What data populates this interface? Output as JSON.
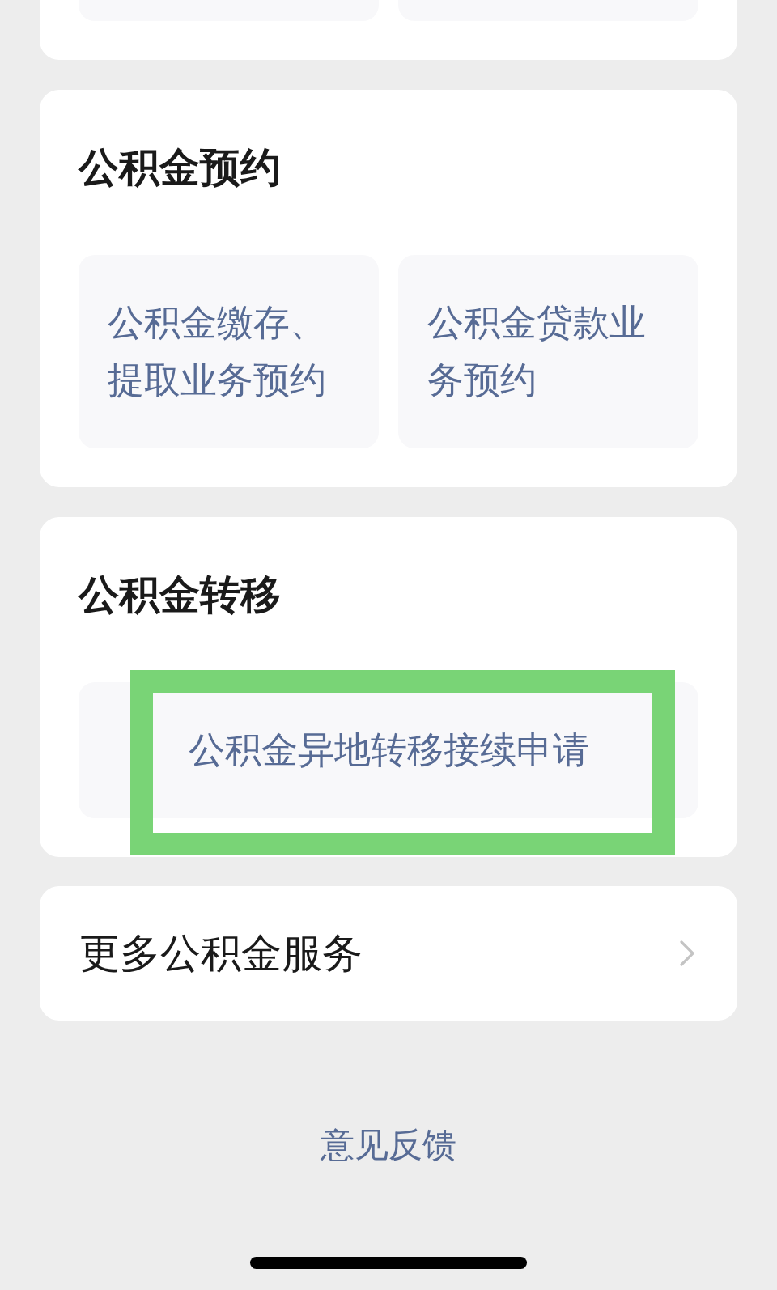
{
  "sections": [
    {
      "kind": "clipped"
    },
    {
      "kind": "tiles",
      "title": "公积金预约",
      "items": [
        {
          "label": "公积金缴存、提取业务预约",
          "highlighted": false
        },
        {
          "label": "公积金贷款业务预约",
          "highlighted": false
        }
      ]
    },
    {
      "kind": "tiles",
      "title": "公积金转移",
      "items": [
        {
          "label": "公积金异地转移接续申请",
          "highlighted": true
        }
      ]
    },
    {
      "kind": "link",
      "label": "更多公积金服务"
    }
  ],
  "feedback_link": "意见反馈"
}
